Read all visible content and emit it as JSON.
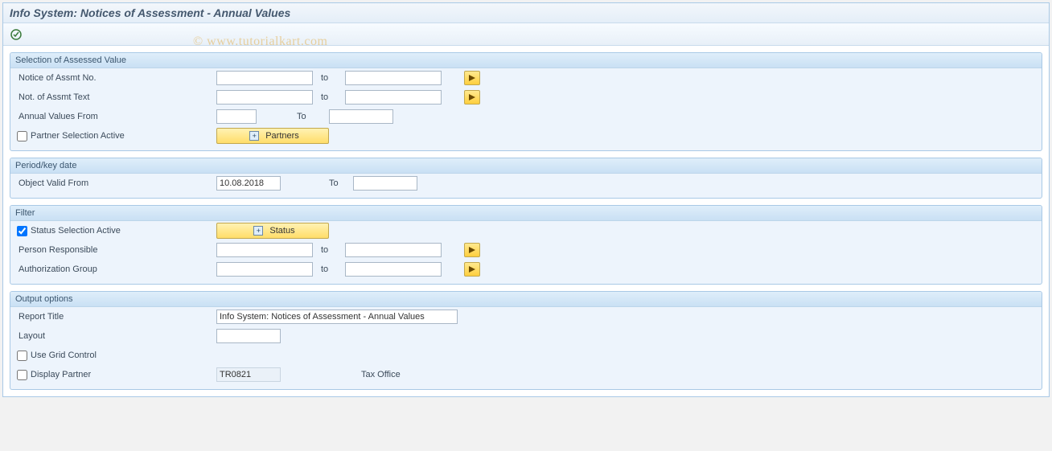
{
  "title": "Info System: Notices of Assessment - Annual Values",
  "watermark": "© www.tutorialkart.com",
  "groups": {
    "sel": {
      "title": "Selection of Assessed Value",
      "assmt_no_label": "Notice of Assmt No.",
      "assmt_no_from": "",
      "assmt_no_to": "",
      "assmt_txt_label": "Not. of Assmt Text",
      "assmt_txt_from": "",
      "assmt_txt_to": "",
      "annual_label": "Annual Values From",
      "annual_from": "",
      "annual_to_label": "To",
      "annual_to": "",
      "partner_sel_label": "Partner Selection Active",
      "partner_sel_checked": false,
      "partners_btn": "Partners",
      "to": "to"
    },
    "period": {
      "title": "Period/key date",
      "valid_from_label": "Object Valid From",
      "valid_from": "10.08.2018",
      "to_label": "To",
      "valid_to": ""
    },
    "filter": {
      "title": "Filter",
      "status_sel_label": "Status Selection Active",
      "status_sel_checked": true,
      "status_btn": "Status",
      "person_label": "Person Responsible",
      "person_from": "",
      "person_to": "",
      "auth_label": "Authorization Group",
      "auth_from": "",
      "auth_to": "",
      "to": "to"
    },
    "output": {
      "title": "Output options",
      "report_title_label": "Report Title",
      "report_title": "Info System: Notices of Assessment - Annual Values",
      "layout_label": "Layout",
      "layout": "",
      "use_grid_label": "Use Grid Control",
      "use_grid_checked": false,
      "display_partner_label": "Display Partner",
      "display_partner_checked": false,
      "partner_code": "TR0821",
      "partner_desc": "Tax Office"
    }
  }
}
